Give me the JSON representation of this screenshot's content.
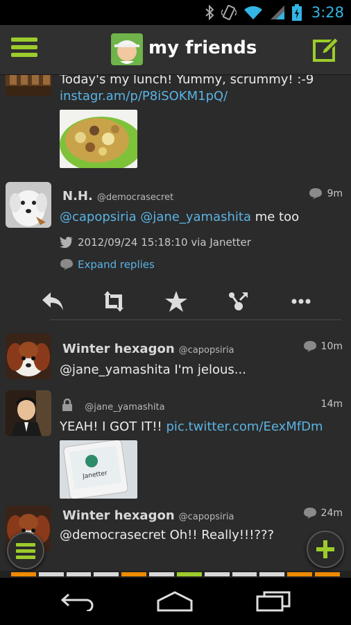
{
  "status_bar": {
    "time": "3:28",
    "icons": [
      "bluetooth-icon",
      "vibrate-icon",
      "wifi-icon",
      "signal-icon",
      "battery-charging-icon"
    ],
    "accent": "#33b5e5"
  },
  "action_bar": {
    "title": "my friends",
    "menu_icon": "menu-icon",
    "compose_icon": "compose-icon",
    "accent": "#9ccc2b"
  },
  "tweets": [
    {
      "text": "Today's my lunch! Yummy, scrummy! :-9",
      "link": "instagr.am/p/P8iSOKM1pQ/",
      "has_thumb": true
    },
    {
      "name": "N.H.",
      "handle": "@democrasecret",
      "time": "9m",
      "mention1": "@capopsiria",
      "mention2": "@jane_yamashita",
      "text_rest": "me too",
      "meta": "2012/09/24 15:18:10  via Janetter",
      "expand": "Expand replies"
    },
    {
      "name": "Winter hexagon",
      "handle": "@capopsiria",
      "time": "10m",
      "text": "@jane_yamashita I'm jelous..."
    },
    {
      "handle": "@jane_yamashita",
      "time": "14m",
      "text": "YEAH! I GOT IT!!",
      "link": "pic.twitter.com/EexMfDm",
      "thumb_label": "Janetter"
    },
    {
      "name": "Winter hexagon",
      "handle": "@capopsiria",
      "time": "24m",
      "text": "@democrasecret Oh!! Really!!!???"
    }
  ],
  "tweet_actions": [
    "reply-icon",
    "retweet-icon",
    "favorite-icon",
    "share-icon",
    "more-icon"
  ],
  "timeline_colors": [
    "#f08a00",
    "#d8d8d8",
    "#d8d8d8",
    "#d8d8d8",
    "#f08a00",
    "#d8d8d8",
    "#9ccc2b",
    "#d8d8d8",
    "#d8d8d8",
    "#d8d8d8",
    "#f08a00",
    "#f08a00"
  ],
  "nav": [
    "back-icon",
    "home-icon",
    "recent-apps-icon"
  ]
}
